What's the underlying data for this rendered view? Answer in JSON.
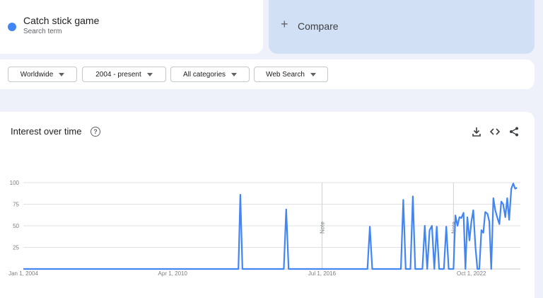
{
  "search_term": {
    "title": "Catch stick game",
    "subtitle": "Search term",
    "color": "#4285f4"
  },
  "compare": {
    "label": "Compare",
    "icon": "plus-icon"
  },
  "filters": [
    {
      "label": "Worldwide"
    },
    {
      "label": "2004 - present"
    },
    {
      "label": "All categories"
    },
    {
      "label": "Web Search"
    }
  ],
  "section": {
    "title": "Interest over time",
    "help_icon": "question-circle-icon",
    "tools": [
      "download-icon",
      "embed-icon",
      "share-icon"
    ]
  },
  "chart_data": {
    "type": "line",
    "title": "",
    "xlabel": "",
    "ylabel": "",
    "ylim": [
      0,
      100
    ],
    "xlim": [
      2004.0,
      2024.8
    ],
    "y_ticks": [
      25,
      50,
      75,
      100
    ],
    "x_ticks": [
      {
        "label": "Jan 1, 2004",
        "x": 2004.0
      },
      {
        "label": "Apr 1, 2010",
        "x": 2010.25
      },
      {
        "label": "Jul 1, 2016",
        "x": 2016.5
      },
      {
        "label": "Oct 1, 2022",
        "x": 2022.75
      }
    ],
    "notes": [
      {
        "label": "Note",
        "x": 2016.5
      },
      {
        "label": "Note",
        "x": 2022.0
      }
    ],
    "grid": true,
    "legend": "none",
    "series": [
      {
        "color": "#4285f4",
        "points": [
          [
            2004.0,
            0
          ],
          [
            2013.0,
            0
          ],
          [
            2013.08,
            86
          ],
          [
            2013.17,
            0
          ],
          [
            2014.9,
            0
          ],
          [
            2015.0,
            69
          ],
          [
            2015.1,
            0
          ],
          [
            2018.4,
            0
          ],
          [
            2018.5,
            49
          ],
          [
            2018.6,
            0
          ],
          [
            2019.8,
            0
          ],
          [
            2019.9,
            80
          ],
          [
            2020.0,
            0
          ],
          [
            2020.2,
            0
          ],
          [
            2020.3,
            84
          ],
          [
            2020.4,
            0
          ],
          [
            2020.7,
            0
          ],
          [
            2020.8,
            50
          ],
          [
            2020.9,
            0
          ],
          [
            2021.0,
            45
          ],
          [
            2021.1,
            50
          ],
          [
            2021.2,
            0
          ],
          [
            2021.3,
            49
          ],
          [
            2021.4,
            0
          ],
          [
            2021.6,
            0
          ],
          [
            2021.7,
            49
          ],
          [
            2021.8,
            0
          ],
          [
            2022.0,
            0
          ],
          [
            2022.08,
            62
          ],
          [
            2022.17,
            50
          ],
          [
            2022.25,
            60
          ],
          [
            2022.33,
            59
          ],
          [
            2022.42,
            65
          ],
          [
            2022.5,
            0
          ],
          [
            2022.58,
            60
          ],
          [
            2022.67,
            33
          ],
          [
            2022.75,
            55
          ],
          [
            2022.83,
            68
          ],
          [
            2022.92,
            25
          ],
          [
            2023.0,
            0
          ],
          [
            2023.08,
            0
          ],
          [
            2023.17,
            45
          ],
          [
            2023.25,
            42
          ],
          [
            2023.33,
            66
          ],
          [
            2023.42,
            64
          ],
          [
            2023.5,
            55
          ],
          [
            2023.58,
            0
          ],
          [
            2023.67,
            82
          ],
          [
            2023.75,
            68
          ],
          [
            2023.83,
            60
          ],
          [
            2023.92,
            52
          ],
          [
            2024.0,
            78
          ],
          [
            2024.08,
            75
          ],
          [
            2024.17,
            60
          ],
          [
            2024.25,
            82
          ],
          [
            2024.33,
            57
          ],
          [
            2024.42,
            93
          ],
          [
            2024.5,
            99
          ],
          [
            2024.58,
            93
          ],
          [
            2024.66,
            94
          ]
        ]
      }
    ]
  }
}
